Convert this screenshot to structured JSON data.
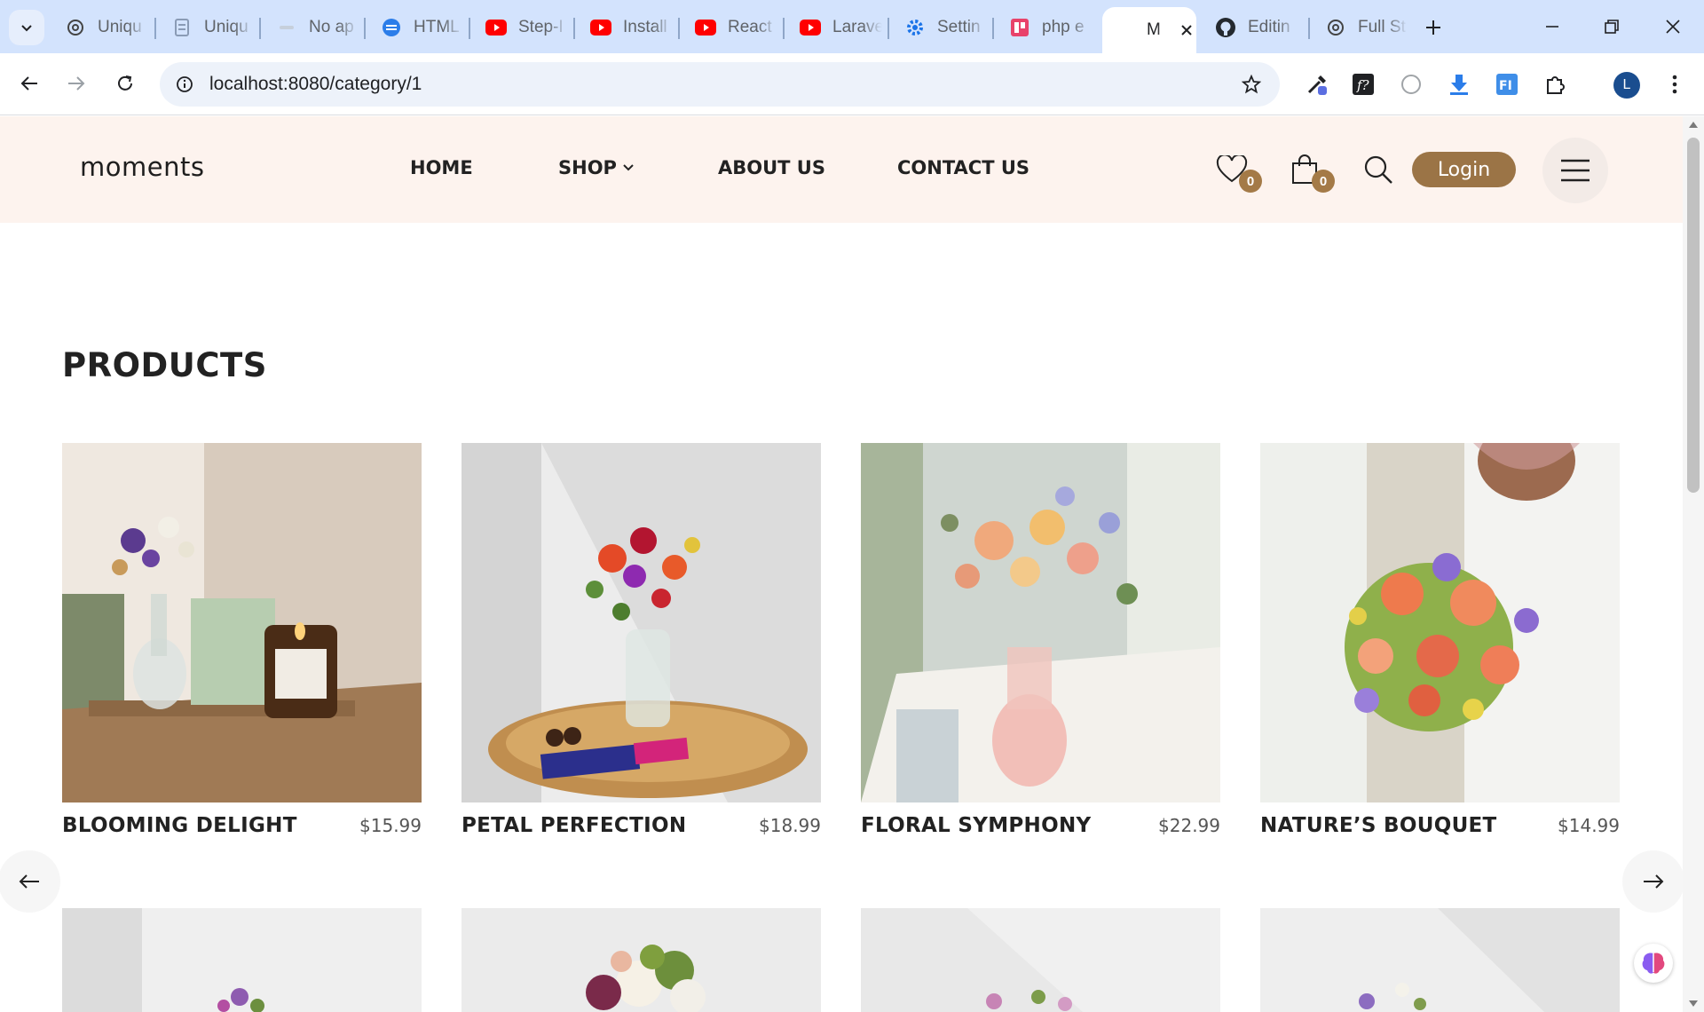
{
  "browser": {
    "tabs": [
      {
        "label": "Uniqu",
        "icon": "chatgpt-icon"
      },
      {
        "label": "Uniqu",
        "icon": "document-icon"
      },
      {
        "label": "No ap",
        "icon": "placeholder-icon"
      },
      {
        "label": "HTML",
        "icon": "html-converter-icon"
      },
      {
        "label": "Step-I",
        "icon": "youtube-icon"
      },
      {
        "label": "Install",
        "icon": "youtube-icon"
      },
      {
        "label": "React",
        "icon": "youtube-icon"
      },
      {
        "label": "Larave",
        "icon": "youtube-icon"
      },
      {
        "label": "Settin",
        "icon": "gear-icon"
      },
      {
        "label": "php e",
        "icon": "course-icon"
      },
      {
        "label": "M",
        "icon": "moments-icon",
        "active": true
      },
      {
        "label": "Editin",
        "icon": "github-icon"
      },
      {
        "label": "Full St",
        "icon": "chatgpt-icon"
      }
    ],
    "url": "localhost:8080/category/1",
    "profile_initial": "L"
  },
  "site": {
    "logo_text": "moments",
    "nav": {
      "home": "HOME",
      "shop": "SHOP",
      "about": "ABOUT US",
      "contact": "CONTACT US"
    },
    "wishlist_count": "0",
    "cart_count": "0",
    "login_label": "Login",
    "accent_color": "#9b7446",
    "header_bg": "#fdf3ee"
  },
  "products": {
    "title": "PRODUCTS",
    "items": [
      {
        "name": "BLOOMING DELIGHT",
        "price": "$15.99"
      },
      {
        "name": "PETAL PERFECTION",
        "price": "$18.99"
      },
      {
        "name": "FLORAL SYMPHONY",
        "price": "$22.99"
      },
      {
        "name": "NATURE’S BOUQUET",
        "price": "$14.99"
      }
    ]
  }
}
